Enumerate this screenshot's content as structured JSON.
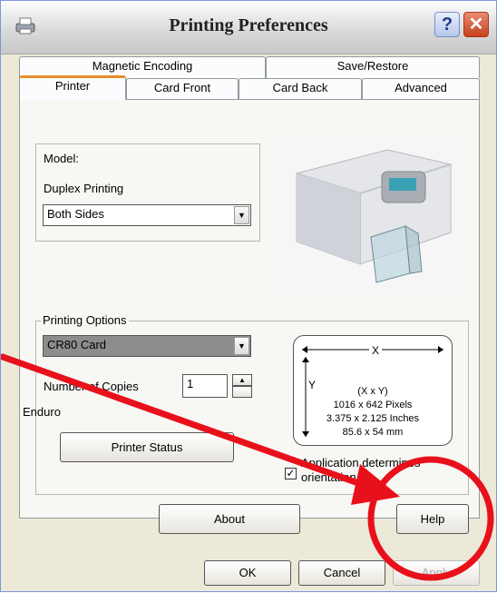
{
  "window": {
    "title": "Printing Preferences",
    "help_button": "?",
    "close_button": "✕"
  },
  "tabs_back": [
    "Magnetic Encoding",
    "Save/Restore"
  ],
  "tabs_front": [
    "Printer",
    "Card Front",
    "Card Back",
    "Advanced"
  ],
  "selected_tab": "Printer",
  "model_group": {
    "model_label": "Model:",
    "duplex_label": "Duplex Printing",
    "duplex_value": "Both Sides"
  },
  "printing_options": {
    "legend": "Printing Options",
    "card_value": "CR80 Card",
    "copies_label": "Number of Copies",
    "copies_value": "1",
    "printer_name": "Enduro",
    "status_button": "Printer Status",
    "orientation_checkbox_label": "Application determines orientation",
    "orientation_checked": true
  },
  "card_dimensions": {
    "x_label": "X",
    "y_label": "Y",
    "line1": "(X x Y)",
    "line2": "1016 x 642 Pixels",
    "line3": "3.375 x 2.125 Inches",
    "line4": "85.6 x 54 mm"
  },
  "buttons": {
    "about": "About",
    "help": "Help",
    "ok": "OK",
    "cancel": "Cancel",
    "apply": "Apply"
  },
  "annotation_color": "#e8101a"
}
